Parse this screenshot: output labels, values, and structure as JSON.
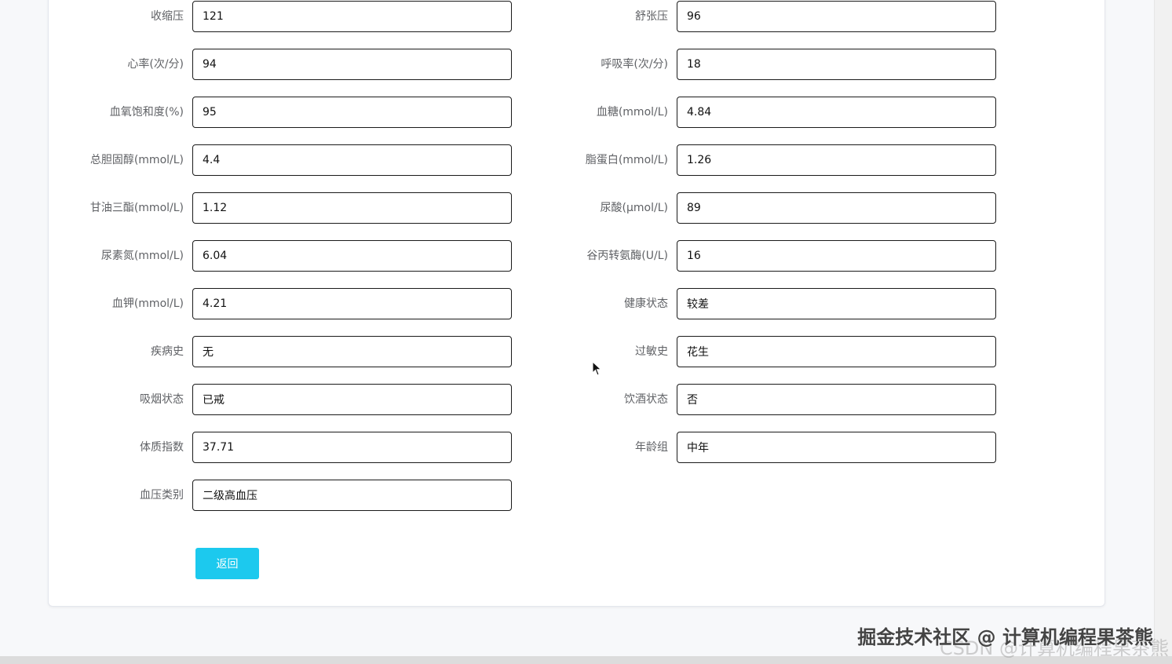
{
  "left_fields": [
    {
      "label": "收缩压",
      "value": "121"
    },
    {
      "label": "心率(次/分)",
      "value": "94"
    },
    {
      "label": "血氧饱和度(%)",
      "value": "95"
    },
    {
      "label": "总胆固醇(mmol/L)",
      "value": "4.4"
    },
    {
      "label": "甘油三酯(mmol/L)",
      "value": "1.12"
    },
    {
      "label": "尿素氮(mmol/L)",
      "value": "6.04"
    },
    {
      "label": "血钾(mmol/L)",
      "value": "4.21"
    },
    {
      "label": "疾病史",
      "value": "无"
    },
    {
      "label": "吸烟状态",
      "value": "已戒"
    },
    {
      "label": "体质指数",
      "value": "37.71"
    },
    {
      "label": "血压类别",
      "value": "二级高血压"
    }
  ],
  "right_fields": [
    {
      "label": "舒张压",
      "value": "96"
    },
    {
      "label": "呼吸率(次/分)",
      "value": "18"
    },
    {
      "label": "血糖(mmol/L)",
      "value": "4.84"
    },
    {
      "label": "脂蛋白(mmol/L)",
      "value": "1.26"
    },
    {
      "label": "尿酸(μmol/L)",
      "value": "89"
    },
    {
      "label": "谷丙转氨酶(U/L)",
      "value": "16"
    },
    {
      "label": "健康状态",
      "value": "较差"
    },
    {
      "label": "过敏史",
      "value": "花生"
    },
    {
      "label": "饮酒状态",
      "value": "否"
    },
    {
      "label": "年龄组",
      "value": "中年"
    }
  ],
  "actions": {
    "back_label": "返回"
  },
  "watermark": {
    "primary": "掘金技术社区 @ 计算机编程果茶熊",
    "secondary": "CSDN @计算机编程果茶熊"
  },
  "colors": {
    "accent": "#1cc9ee",
    "input_border": "#1a1a1a",
    "label": "#606266"
  }
}
